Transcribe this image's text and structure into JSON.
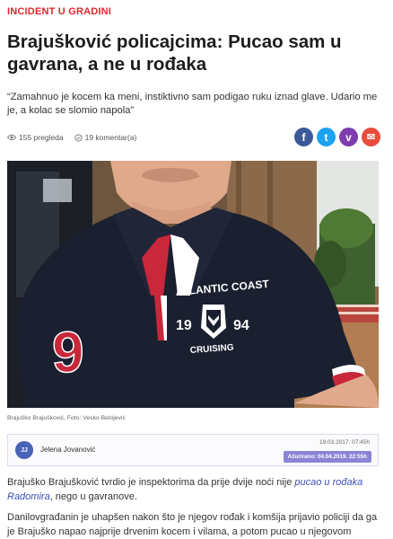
{
  "article": {
    "category": "INCIDENT U GRADINI",
    "headline": "Brajušković policajcima: Pucao sam u gavrana, a ne u rođaka",
    "lead": "“Zamahnuo je kocem ka meni, instiktivno sam podigao ruku iznad glave. Udario me je, a kolac se slomio napola”",
    "views": "155 pregleda",
    "comments": "19 komentar(a)",
    "photo_caption": "Brajuško Brajušković, Foto: Vesko Belojević",
    "photo_shirt_text": {
      "top": "ATLANTIC COAST",
      "num_left": "19",
      "num_right": "94",
      "bottom": "CRUISING",
      "big_number": "9"
    },
    "author": {
      "initials": "JJ",
      "name": "Jelena Jovanović",
      "published": "19.03.2017. 07:45h",
      "updated": "Ažurirano: 04.04.2019. 22:55h"
    },
    "p1_before": "Brajuško Brajušković tvrdio je inspektorima da prije dvije noći nije ",
    "p1_link": "pucao u rođaka Radomira",
    "p1_after": ", nego u gavranove.",
    "p2": "Danilovgrađanin je uhapšen nakon što je njegov rođak i komšija prijavio policiji da ga je Brajuško napao najprije  drvenim kocem i vilama, a potom pucao u njegovom pravcu."
  },
  "share": {
    "facebook_glyph": "f",
    "twitter_glyph": "t",
    "viber_glyph": "v",
    "email_glyph": "✉",
    "facebook_color": "#3b5998",
    "twitter_color": "#1da1f2",
    "viber_color": "#7d3daf",
    "email_color": "#e84c3d"
  },
  "theme": {
    "accent": "#e0262b",
    "link": "#3b50b4",
    "badge": "#8b84d6"
  },
  "icons": [
    "eye-icon",
    "comment-icon",
    "facebook-icon",
    "twitter-icon",
    "viber-icon",
    "email-icon",
    "avatar"
  ]
}
